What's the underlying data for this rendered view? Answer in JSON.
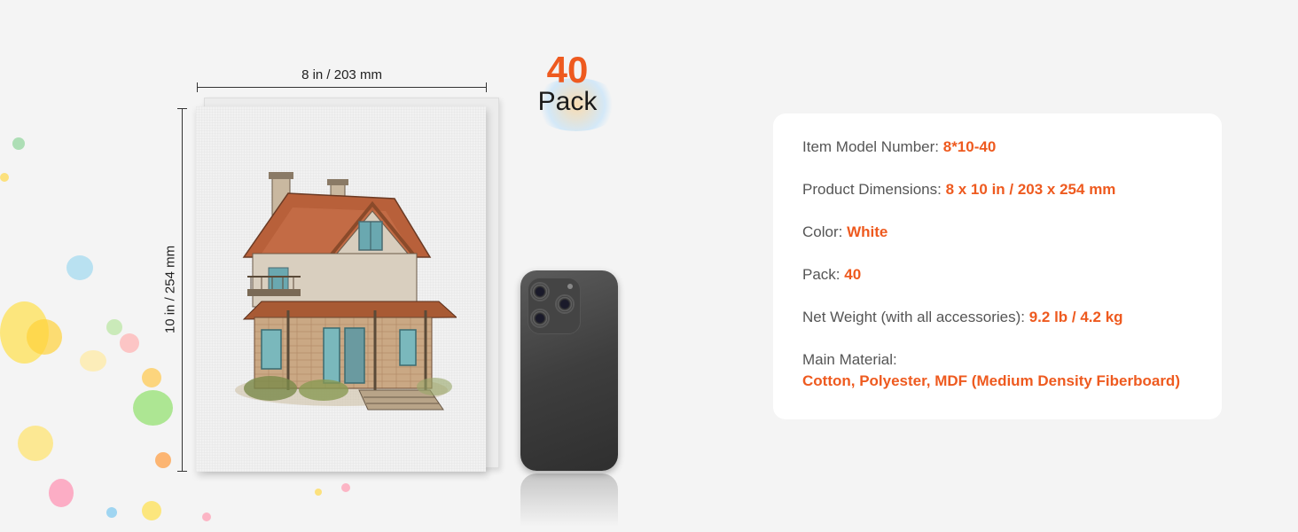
{
  "dimensions": {
    "width_label": "8 in / 203 mm",
    "height_label": "10 in / 254 mm"
  },
  "pack_badge": {
    "number": "40",
    "word": "Pack"
  },
  "specs": [
    {
      "label": "Item Model Number: ",
      "value": "8*10-40"
    },
    {
      "label": "Product Dimensions: ",
      "value": "8 x 10 in / 203 x 254 mm"
    },
    {
      "label": "Color: ",
      "value": "White"
    },
    {
      "label": "Pack: ",
      "value": "40"
    },
    {
      "label": "Net Weight (with all accessories): ",
      "value": "9.2 lb / 4.2 kg"
    },
    {
      "label": "Main Material:",
      "value": "Cotton, Polyester, MDF (Medium Density Fiberboard)"
    }
  ],
  "colors": {
    "accent": "#ee5a1f",
    "label": "#555555",
    "background": "#f4f4f4",
    "card": "#ffffff"
  },
  "icons": [
    "canvas-panel-image",
    "smartphone-image",
    "paint-splash-decoration"
  ]
}
